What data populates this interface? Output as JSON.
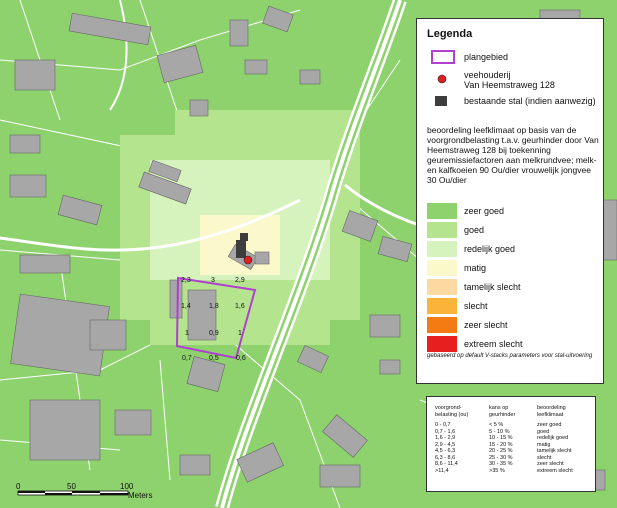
{
  "legend": {
    "title": "Legenda",
    "plangebied": "plangebied",
    "veehouderij_line1": "veehouderij",
    "veehouderij_line2": "Van Heemstraweg 128",
    "stal": "bestaande stal (indien aanwezig)",
    "description": "beoordeling leefklimaat op basis van de voorgrondbelasting t.a.v. geurhinder door Van Heemstraweg 128 bij toekenning geuremissiefactoren aan melkrundvee; melk- en kalfkoeien 90 Ou/dier vrouwelijk jongvee 30 Ou/dier",
    "classes": [
      {
        "label": "zeer goed",
        "color": "#8ed26e"
      },
      {
        "label": "goed",
        "color": "#b4e48e"
      },
      {
        "label": "redelijk goed",
        "color": "#d6f3bd"
      },
      {
        "label": "matig",
        "color": "#fbf8cc"
      },
      {
        "label": "tamelijk slecht",
        "color": "#fcd9a0"
      },
      {
        "label": "slecht",
        "color": "#fbb43a"
      },
      {
        "label": "zeer slecht",
        "color": "#f47a14"
      },
      {
        "label": "extreem slecht",
        "color": "#e81f1f"
      }
    ],
    "footnote": "gebaseerd op default V-stacks parameters voor stal-uitvoering",
    "plangebied_color": "#b13fd0",
    "veehouderij_color": "#e02020",
    "stal_color": "#3d3d3d"
  },
  "table": {
    "head1": "voorgrond-\nbelasting (ou)",
    "head2": "kans op\ngeurhinder",
    "head3": "beoordeling\nleefklimaat",
    "col1": [
      "0 - 0,7",
      "0,7 - 1,6",
      "1,6 - 2,9",
      "2,9 - 4,5",
      "4,5 - 6,3",
      "6,3 - 8,6",
      "8,6 - 11,4",
      ">11,4"
    ],
    "col2": [
      "< 5 %",
      "5 - 10 %",
      "10 - 15 %",
      "15 - 20 %",
      "20 - 25 %",
      "25 - 30 %",
      "30 - 35 %",
      ">35 %"
    ],
    "col3": [
      "zeer goed",
      "goed",
      "redelijk goed",
      "matig",
      "tamelijk slecht",
      "slecht",
      "zeer slecht",
      "extreem slecht"
    ]
  },
  "map": {
    "grid_values": [
      "2,3",
      "3",
      "2,9",
      "1,4",
      "1,8",
      "1,6",
      "1",
      "0,9",
      "1",
      "0,7",
      "0,5",
      "0,6"
    ],
    "scale": {
      "v0": "0",
      "v50": "50",
      "v100": "100",
      "unit": "Meters"
    },
    "colors": {
      "base": "#8ed26e",
      "road": "#ffffff",
      "building": "#a7a7a7"
    }
  }
}
